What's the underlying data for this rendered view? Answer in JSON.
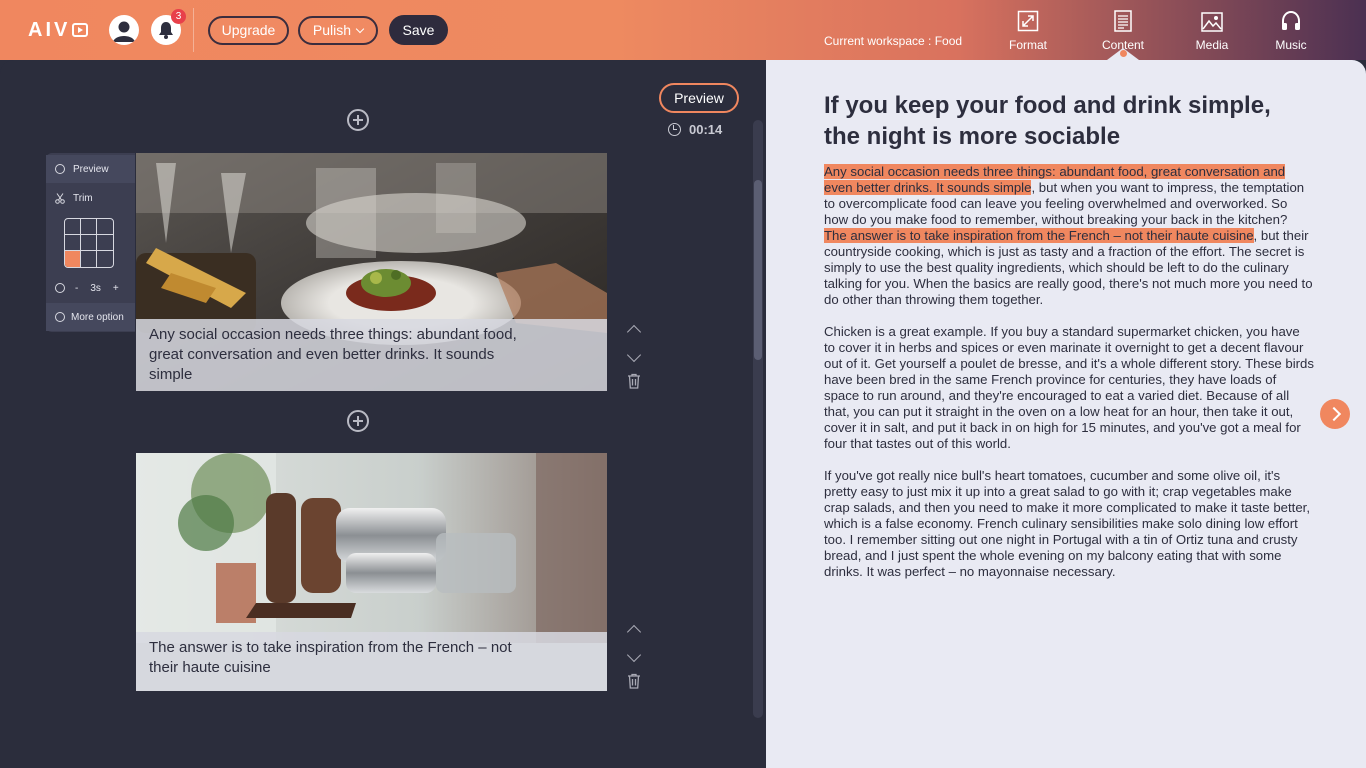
{
  "header": {
    "logo_text": "AIVO",
    "notifications_count": "3",
    "upgrade_label": "Upgrade",
    "publish_label": "Pulish",
    "save_label": "Save",
    "workspace_label": "Current workspace : Food",
    "nav": [
      {
        "label": "Format",
        "icon": "format-icon"
      },
      {
        "label": "Content",
        "icon": "content-icon",
        "active": true
      },
      {
        "label": "Media",
        "icon": "media-icon"
      },
      {
        "label": "Music",
        "icon": "music-icon"
      }
    ]
  },
  "editor": {
    "preview_label": "Preview",
    "duration": "00:14",
    "tools": {
      "preview": "Preview",
      "trim": "Trim",
      "duration_minus": "-",
      "duration_value": "3s",
      "duration_plus": "+",
      "more": "More option",
      "text_position_selected": "bottom-left"
    },
    "scenes": [
      {
        "caption": "Any social occasion needs three things: abundant food, great conversation and even better drinks. It sounds simple",
        "image": "restaurant-table-photo"
      },
      {
        "caption": "The answer is to take inspiration from the French – not their haute cuisine",
        "image": "espresso-machine-photo"
      }
    ]
  },
  "article": {
    "title": "If you keep your food and drink simple, the night is more sociable",
    "p1_highlight": "Any social occasion needs three things: abundant food, great conversation and even better drinks. It sounds simple",
    "p1_rest": ", but when you want to impress, the temptation to overcomplicate food can leave you feeling overwhelmed and overworked. So how do you make food to remember, without breaking your back in the kitchen?",
    "p1b_highlight": "The answer is to take inspiration from the French – not their haute cuisine",
    "p1b_rest": ", but their countryside cooking, which is just as tasty and a fraction of the effort. The secret is simply to use the best quality ingredients, which should be left to do the culinary talking for you. When the basics are really good, there's not much more you need to do other than throwing them together.",
    "p2": "Chicken is a great example. If you buy a standard supermarket chicken, you have to cover it in herbs and spices or even marinate it overnight to get a decent flavour out of it. Get yourself a poulet de bresse, and it's a whole different story. These birds have been bred in the same French province for centuries, they have loads of space to run around, and they're encouraged to eat a varied diet. Because of all that, you can put it straight in the oven on a low heat for an hour, then take it out, cover it in salt, and put it back in on high for 15 minutes, and you've got a meal for four that tastes out of this world.",
    "p3": "If you've got really nice bull's heart tomatoes, cucumber and some olive oil, it's pretty easy to just mix it up into a great salad to go with it; crap vegetables make crap salads, and then you need to make it more complicated to make it taste better, which is a false economy. French culinary sensibilities make solo dining low effort too. I remember sitting out one night in Portugal with a tin of Ortiz tuna and crusty bread, and I just spent the whole evening on my balcony eating that with some drinks. It was perfect – no mayonnaise necessary."
  },
  "colors": {
    "accent": "#f0875f",
    "editor_bg": "#2b2d3c",
    "content_bg": "#e9eaf3",
    "highlight": "#f0875f"
  }
}
